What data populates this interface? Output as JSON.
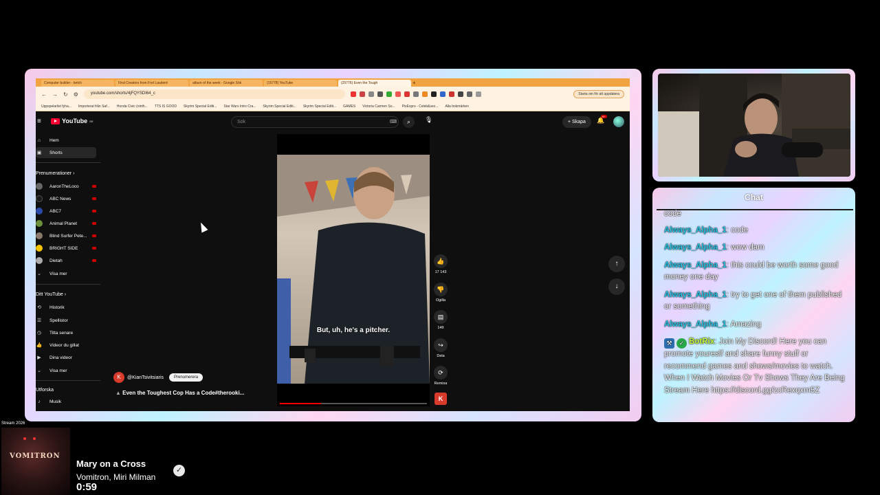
{
  "browser": {
    "tabs": [
      "Computer builder - betch",
      "Find Creators from Fort Lauderd",
      "album of the week - Google Sök",
      "(15778) YouTube",
      "(25776) Even the Tough",
      ""
    ],
    "url": "youtube.com/shorts/4jFQYSDI64_c",
    "update_button": "Starta om för att uppdatera",
    "bookmarks": [
      "Uppspelarlist fyha...",
      "Importerat från Saf...",
      "Honda Civic (ninth...",
      "TTS IS GOOD",
      "Skyrim Special Editi...",
      "Star Wars Intro Cra...",
      "Skyrim Special Editi...",
      "Skyrim Special Editi...",
      "GAMES",
      "Victoria Carmen So...",
      "PixExpro - Celeb&sex...",
      "Alla bokmärken"
    ]
  },
  "youtube": {
    "logo": "YouTube",
    "logo_region": "SE",
    "search_placeholder": "Sök",
    "create_label": "Skapa",
    "notification_count": "9+",
    "sidebar": {
      "main": [
        {
          "icon": "home-icon",
          "label": "Hem"
        },
        {
          "icon": "shorts-icon",
          "label": "Shorts"
        }
      ],
      "subscriptions_heading": "Prenumerationer",
      "subscriptions": [
        {
          "label": "AaronTheLoco",
          "color": "#666666"
        },
        {
          "label": "ABC News",
          "color": "#1a1a1a"
        },
        {
          "label": "ABC7",
          "color": "#2b4aa8"
        },
        {
          "label": "Animal Planet",
          "color": "#6b8f3a"
        },
        {
          "label": "Blind Surfer Pete...",
          "color": "#8a7a6a"
        },
        {
          "label": "BRIGHT SIDE",
          "color": "#f2c200"
        },
        {
          "label": "Dietah",
          "color": "#aaaaaa"
        }
      ],
      "show_more": "Visa mer",
      "you_heading": "Ditt YouTube",
      "you_items": [
        {
          "icon": "history-icon",
          "label": "Historik"
        },
        {
          "icon": "playlist-icon",
          "label": "Spellistor"
        },
        {
          "icon": "watch-later-icon",
          "label": "Titta senare"
        },
        {
          "icon": "liked-icon",
          "label": "Videor du gillat"
        },
        {
          "icon": "your-videos-icon",
          "label": "Dina videor"
        },
        {
          "icon": "chevron-down-icon",
          "label": "Visa mer"
        }
      ],
      "explore_heading": "Utforska",
      "explore_items": [
        {
          "icon": "music-icon",
          "label": "Musik"
        }
      ]
    },
    "short": {
      "subtitle": "But, uh, he's a pitcher.",
      "progress": 0.28,
      "channel_initial": "K",
      "channel_name": "@KianTsivitsiaris",
      "subscribe_label": "Prenumerera",
      "title": "Even the Toughest Cop Has a Code#therooki...",
      "actions": {
        "like_count": "17 143",
        "dislike_label": "Ogilla",
        "comment_count": "149",
        "share_label": "Dela",
        "remix_label": "Remixa"
      }
    }
  },
  "chat": {
    "title": "Chat",
    "messages": [
      {
        "user": "",
        "text": "code"
      },
      {
        "user": "Always_Alpha_1",
        "sep": ": ",
        "text": "code"
      },
      {
        "user": "Always_Alpha_1",
        "sep": ": ",
        "text": "wow dam"
      },
      {
        "user": "Always_Alpha_1",
        "sep": ": ",
        "text": "this could be worth some good money one day"
      },
      {
        "user": "Always_Alpha_1",
        "sep": ": ",
        "text": "try to get one of them published or something"
      },
      {
        "user": "Always_Alpha_1",
        "sep": ": ",
        "text": "Amazing"
      },
      {
        "user": "BotRix",
        "sep": ": ",
        "text": "Join My Discord! Here you can promote youreslf and share funny stuff or recommend games and shows/movies to watch. When I Watch Movies Or Tv Shows They Are Being Stream Here https://discord.gg/zcRexqxm5Z"
      }
    ]
  },
  "now_playing": {
    "label": "Stream 2026",
    "album_art_text": "VOMITRON",
    "song": "Mary on a Cross",
    "artist": "Vomitron, Miri Milman",
    "time": "0:59"
  }
}
